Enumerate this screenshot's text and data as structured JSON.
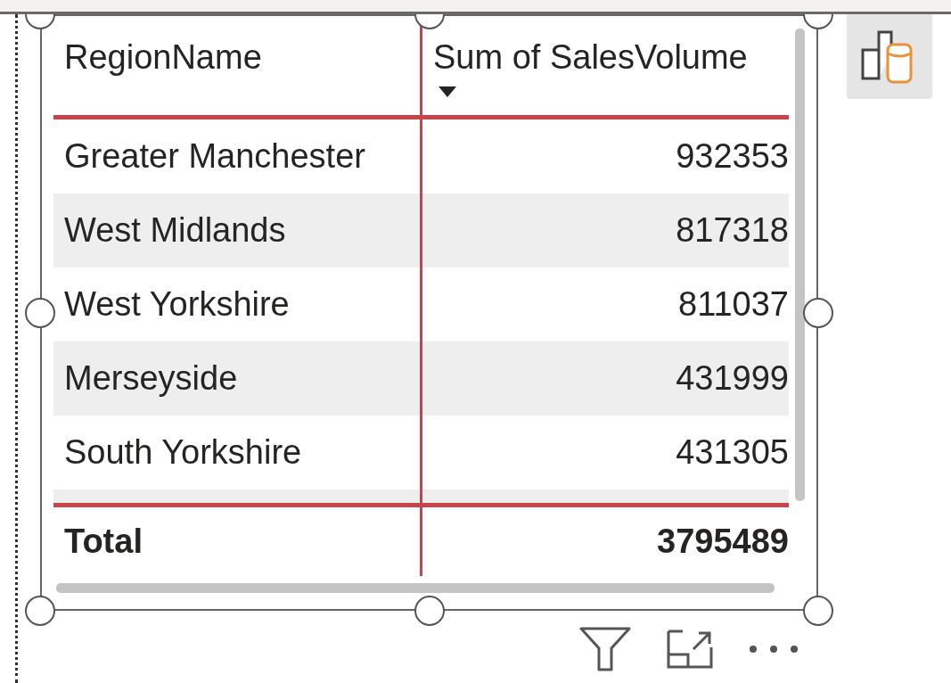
{
  "table": {
    "columns": [
      {
        "label": "RegionName",
        "sort_descending": false
      },
      {
        "label": "Sum of SalesVolume",
        "sort_descending": true
      }
    ],
    "rows": [
      {
        "region": "Greater Manchester",
        "value": "932353"
      },
      {
        "region": "West Midlands",
        "value": "817318"
      },
      {
        "region": "West Yorkshire",
        "value": "811037"
      },
      {
        "region": "Merseyside",
        "value": "431999"
      },
      {
        "region": "South Yorkshire",
        "value": "431305"
      }
    ],
    "total": {
      "label": "Total",
      "value": "3795489"
    }
  }
}
